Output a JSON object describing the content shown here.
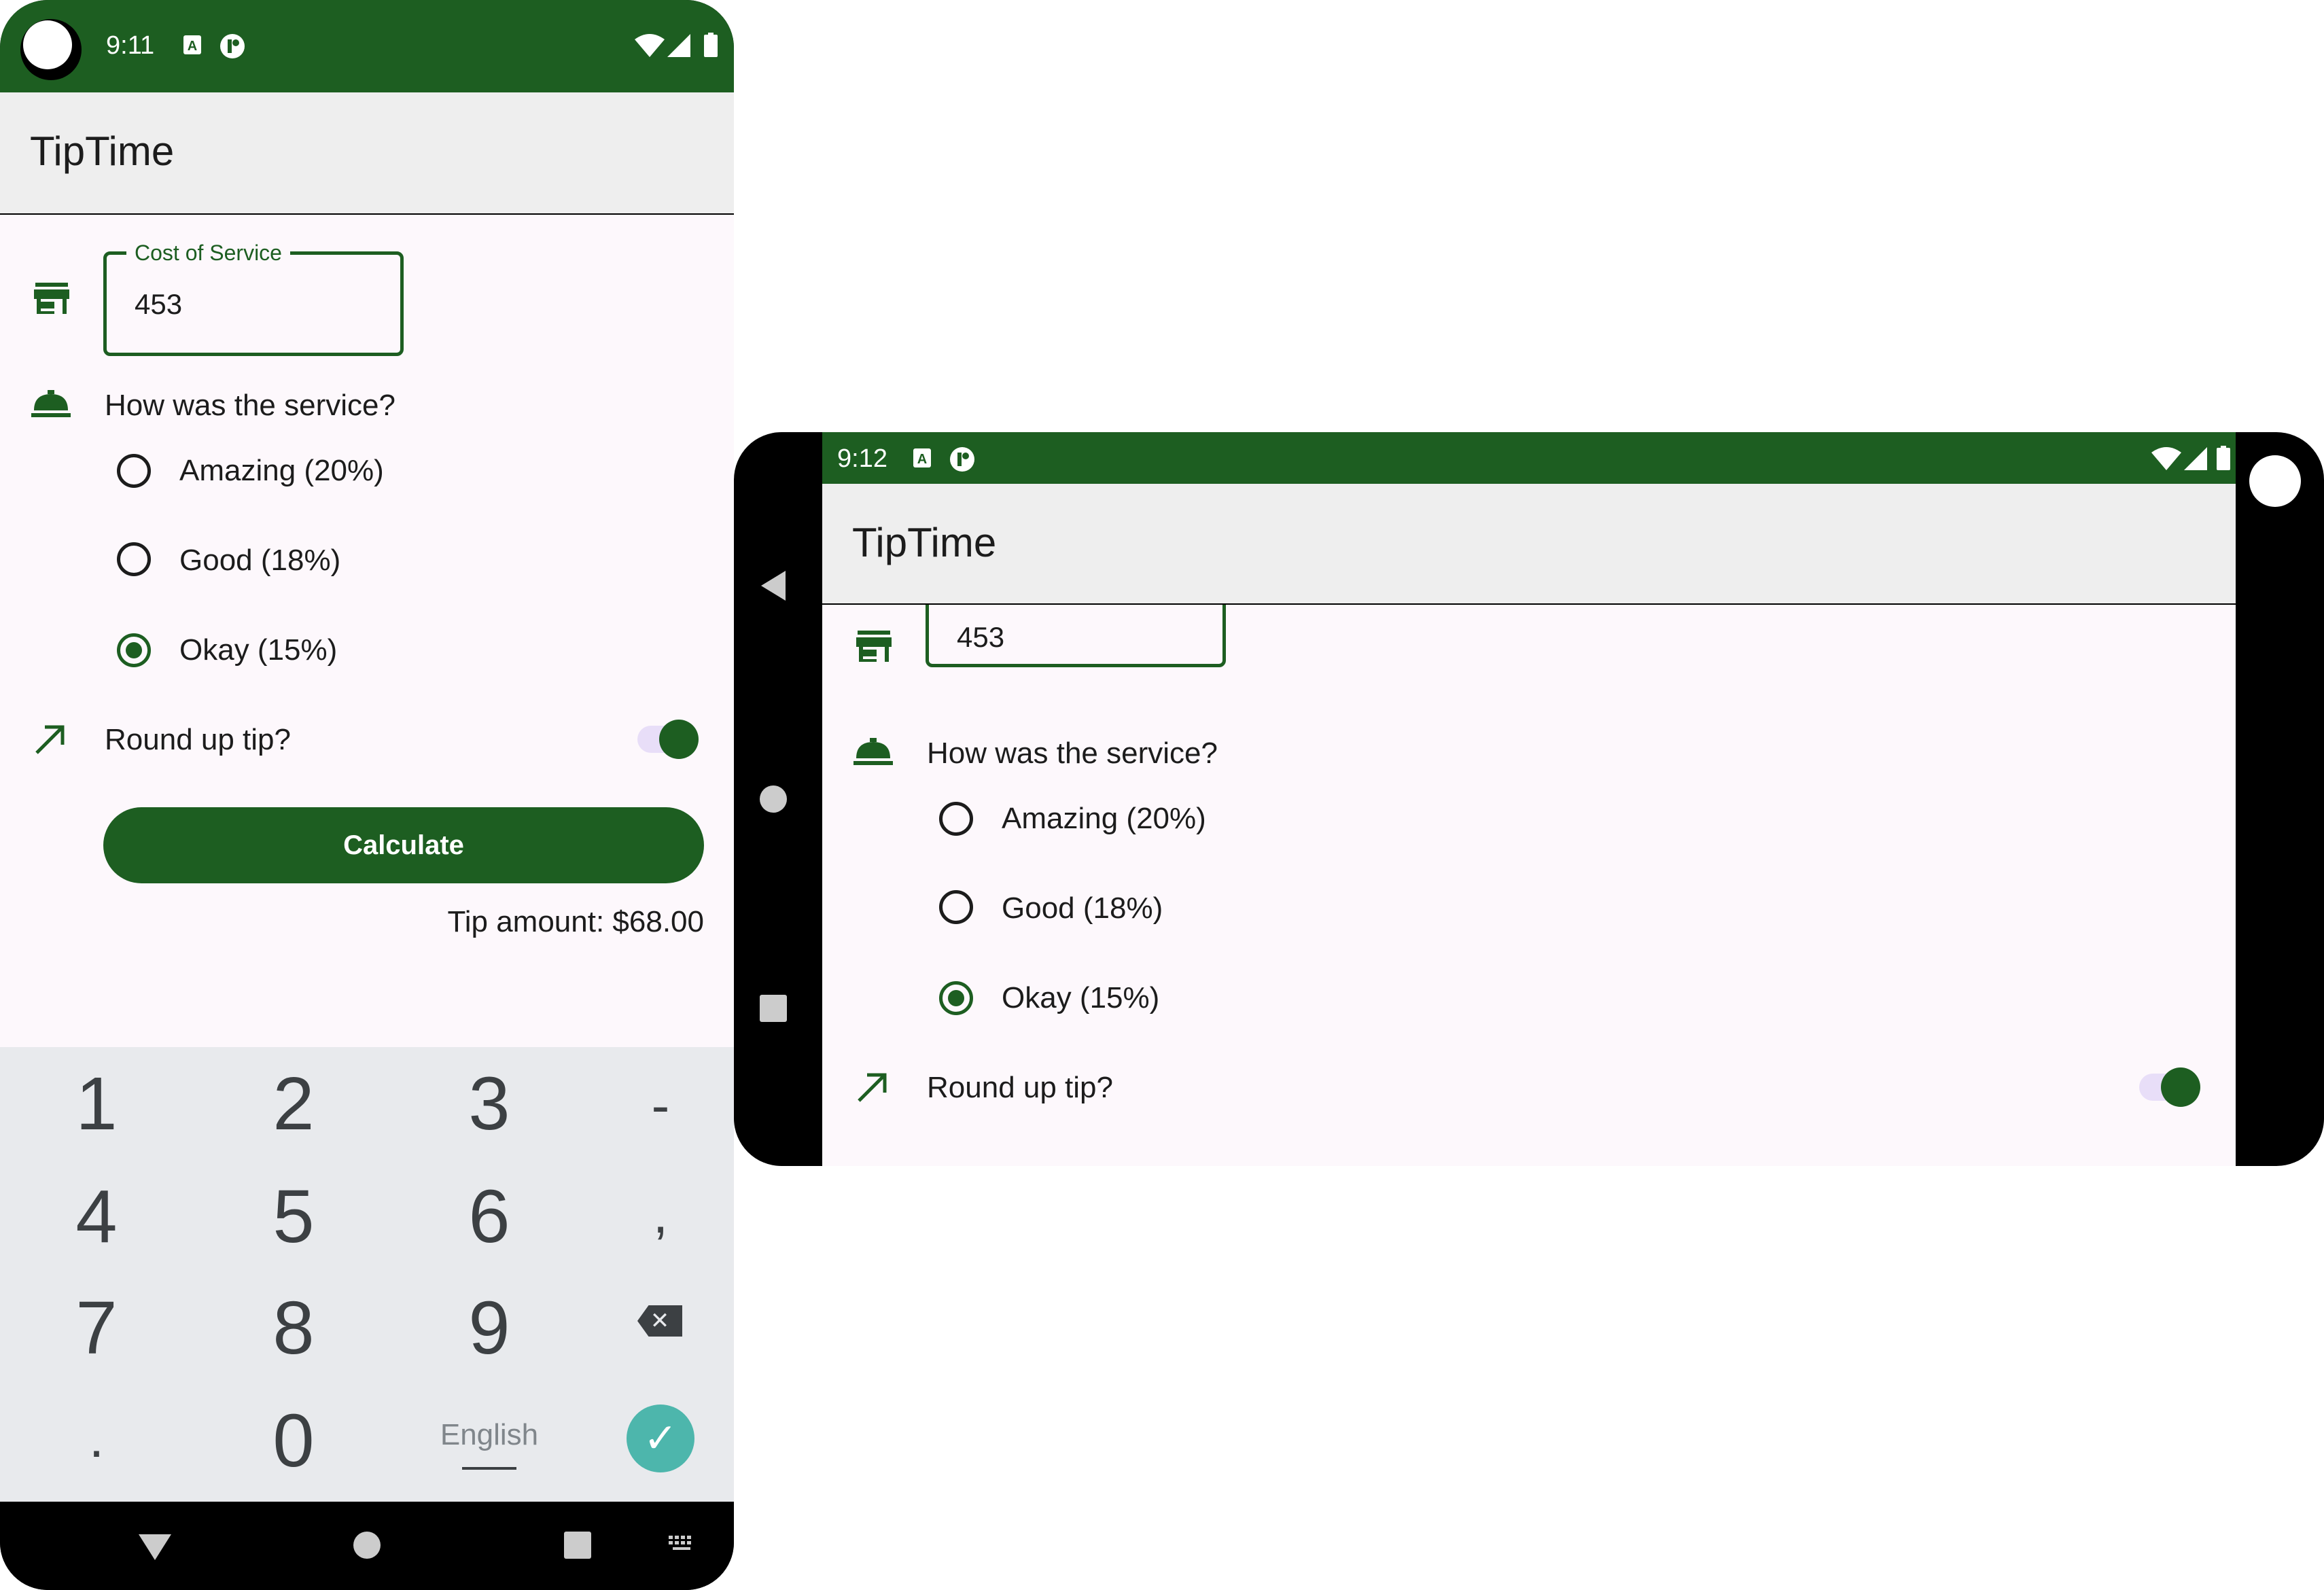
{
  "portrait": {
    "status": {
      "time": "9:11"
    },
    "app_title": "TipTime",
    "cost_field": {
      "label": "Cost of Service",
      "value": "453"
    },
    "question": "How was the service?",
    "options": [
      {
        "label": "Amazing (20%)",
        "selected": false
      },
      {
        "label": "Good (18%)",
        "selected": false
      },
      {
        "label": "Okay (15%)",
        "selected": true
      }
    ],
    "round_up": {
      "label": "Round up tip?",
      "on": true
    },
    "calculate_label": "Calculate",
    "tip_amount": "Tip amount: $68.00",
    "keyboard": {
      "keys": [
        "1",
        "2",
        "3",
        "-",
        "4",
        "5",
        "6",
        ",",
        "7",
        "8",
        "9",
        ".",
        "0"
      ],
      "language": "English"
    }
  },
  "landscape": {
    "status": {
      "time": "9:12"
    },
    "app_title": "TipTime",
    "cost_value": "453",
    "question": "How was the service?",
    "options": [
      {
        "label": "Amazing (20%)",
        "selected": false
      },
      {
        "label": "Good (18%)",
        "selected": false
      },
      {
        "label": "Okay (15%)",
        "selected": true
      }
    ],
    "round_up": {
      "label": "Round up tip?",
      "on": true
    }
  },
  "colors": {
    "primary": "#1d5e21",
    "background": "#fdf8fc",
    "app_bar": "#eeeeee",
    "keyboard": "#e8eaed",
    "done_key": "#4db6ac"
  },
  "icons": [
    "store-icon",
    "room-service-icon",
    "trending-up-icon",
    "wifi-icon",
    "signal-icon",
    "battery-icon",
    "backspace-icon",
    "check-icon"
  ]
}
